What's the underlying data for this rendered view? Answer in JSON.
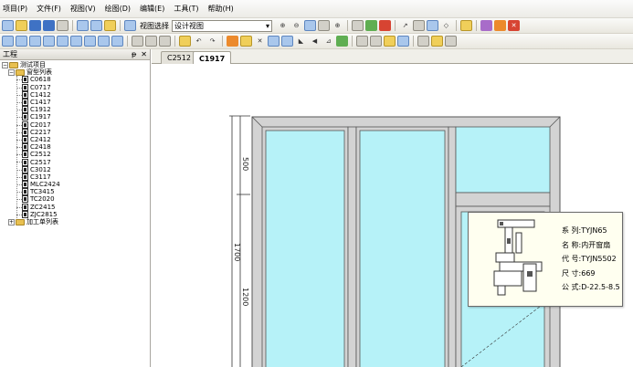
{
  "menu": [
    {
      "label": "项目(P)"
    },
    {
      "label": "文件(F)"
    },
    {
      "label": "视图(V)"
    },
    {
      "label": "绘图(D)"
    },
    {
      "label": "编辑(E)"
    },
    {
      "label": "工具(T)"
    },
    {
      "label": "帮助(H)"
    }
  ],
  "toolbar1": {
    "view_select_label": "视图选择",
    "view_select_value": "设计视图",
    "icons": [
      "new-icon",
      "open-icon",
      "save-icon",
      "save-all-icon",
      "print-icon",
      "copy-icon",
      "paste-icon",
      "cut-icon",
      "window-icon",
      "zoom-in-icon",
      "zoom-out-icon",
      "zoom-fit-icon",
      "zoom-window-icon",
      "zoom-all-icon",
      "list-icon",
      "measure-icon",
      "flip-icon",
      "arrow-icon",
      "export-icon",
      "grid-icon",
      "diamond-icon",
      "tools-icon",
      "color-icon",
      "layer-icon",
      "close-icon"
    ]
  },
  "toolbar2": {
    "icons": [
      "frame-icon",
      "panel-icon",
      "mullion-icon",
      "transom-icon",
      "sash-icon",
      "glass-icon",
      "split-h-icon",
      "split-v-icon",
      "grid-2-icon",
      "table-icon",
      "outline-icon",
      "copy-2-icon",
      "bolt-icon",
      "undo-icon",
      "redo-icon",
      "palette-icon",
      "wrench-icon",
      "delete-icon",
      "align-left-icon",
      "align-right-icon",
      "triangle-icon",
      "arrow-left-icon",
      "slope-icon",
      "ruler-icon",
      "grid-3-icon",
      "grid-4-icon",
      "dim-icon",
      "chart-icon",
      "stack-icon",
      "chain-icon",
      "gear-icon"
    ]
  },
  "left_panel": {
    "title": "工程",
    "pin_label": "ᵽ",
    "close_label": "✕",
    "tree": {
      "root": "测试项目",
      "group1": "窗型列表",
      "items": [
        "C0618",
        "C0717",
        "C1412",
        "C1417",
        "C1912",
        "C1917",
        "C2017",
        "C2217",
        "C2412",
        "C2418",
        "C2512",
        "C2517",
        "C3012",
        "C3117",
        "MLC2424",
        "TC3415",
        "TC2020",
        "ZC2415",
        "ZJC2815"
      ],
      "group2": "加工单列表"
    }
  },
  "tabs": [
    {
      "label": "C2512",
      "active": false
    },
    {
      "label": "C1917",
      "active": true
    }
  ],
  "drawing": {
    "dims": {
      "top_segment": "500",
      "lower_segment": "1200",
      "total_height": "1700"
    },
    "colors": {
      "glass": "#b6f2f8",
      "frame": "#d3d3d3",
      "frame_stroke": "#555555"
    }
  },
  "tooltip": {
    "lines": [
      {
        "key": "系 列:",
        "value": "TYJN65"
      },
      {
        "key": "名 称:",
        "value": "内开窗扇"
      },
      {
        "key": "代 号:",
        "value": "TYJN5502"
      },
      {
        "key": "尺 寸:",
        "value": "669"
      },
      {
        "key": "公 式:",
        "value": "D-22.5-8.5"
      }
    ]
  }
}
